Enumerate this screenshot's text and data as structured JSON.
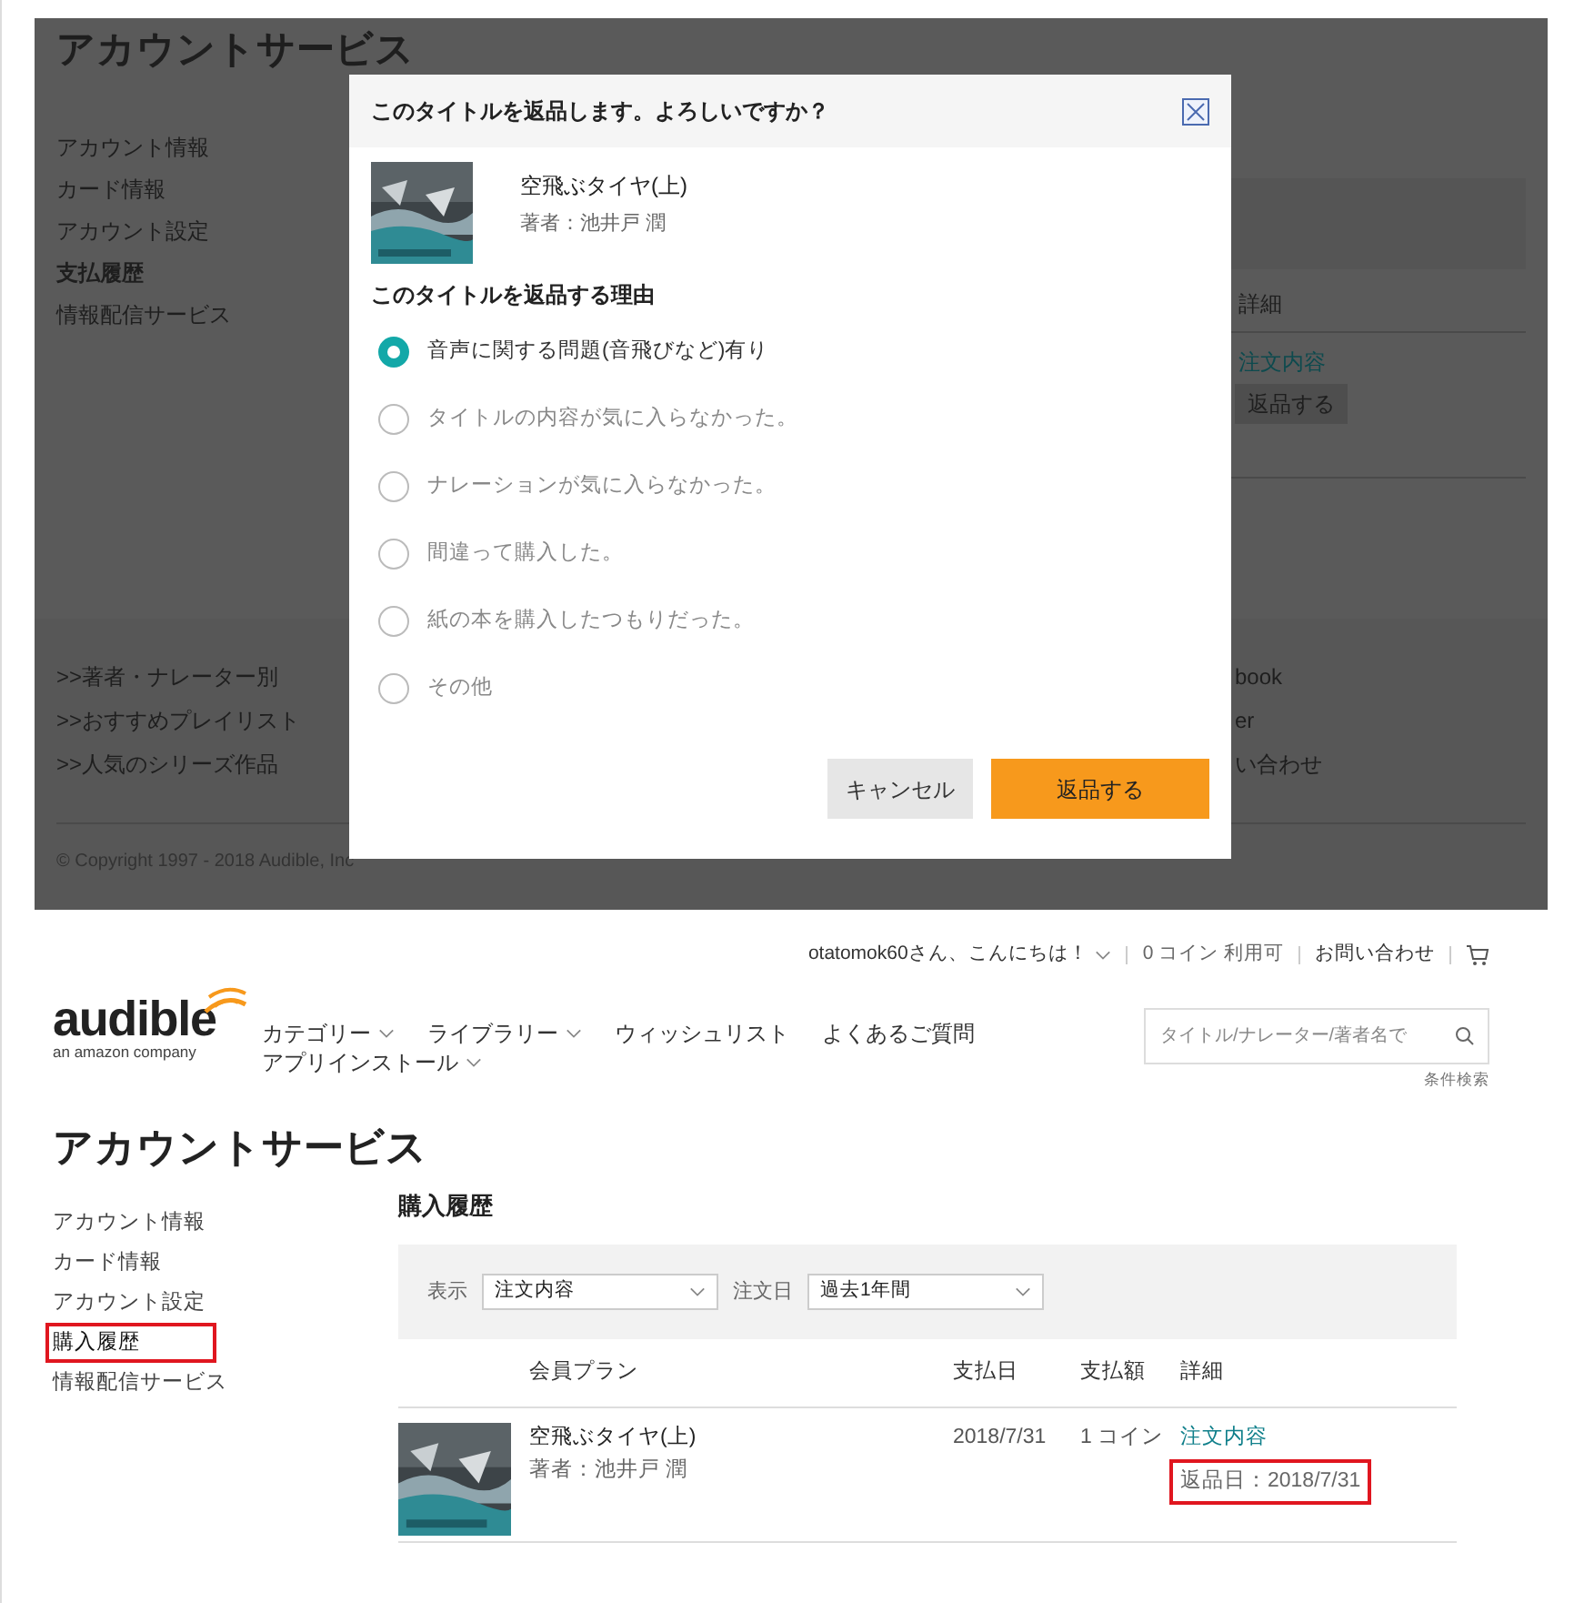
{
  "background_page": {
    "title": "アカウントサービス",
    "sidebar": [
      {
        "label": "アカウント情報",
        "selected": false
      },
      {
        "label": "カード情報",
        "selected": false
      },
      {
        "label": "アカウント設定",
        "selected": false
      },
      {
        "label": "支払履歴",
        "selected": true
      },
      {
        "label": "情報配信サービス",
        "selected": false
      }
    ],
    "detail_header": "詳細",
    "order_link": "注文内容",
    "return_button": "返品する",
    "footer_links": [
      ">>著者・ナレーター別",
      ">>おすすめプレイリスト",
      ">>人気のシリーズ作品"
    ],
    "footer_right": [
      "book",
      "er",
      "い合わせ"
    ],
    "copyright": "© Copyright 1997 - 2018 Audible, Inc"
  },
  "dialog": {
    "title": "このタイトルを返品します。よろしいですか？",
    "book": {
      "title": "空飛ぶタイヤ(上)",
      "author": "著者：池井戸 潤"
    },
    "reason_heading": "このタイトルを返品する理由",
    "reasons": [
      {
        "label": "音声に関する問題(音飛びなど)有り",
        "selected": true
      },
      {
        "label": "タイトルの内容が気に入らなかった。",
        "selected": false
      },
      {
        "label": "ナレーションが気に入らなかった。",
        "selected": false
      },
      {
        "label": "間違って購入した。",
        "selected": false
      },
      {
        "label": "紙の本を購入したつもりだった。",
        "selected": false
      },
      {
        "label": "その他",
        "selected": false
      }
    ],
    "buttons": [
      {
        "label": "キャンセル",
        "kind": "secondary"
      },
      {
        "label": "返品する",
        "kind": "primary"
      }
    ]
  },
  "page": {
    "header": {
      "greeting": "otatomok60さん、こんにちは！",
      "coins": "0 コイン 利用可",
      "contact": "お問い合わせ",
      "logo": {
        "name": "audible",
        "tagline": "an amazon company"
      },
      "nav": [
        {
          "label": "カテゴリー",
          "dropdown": true
        },
        {
          "label": "ライブラリー",
          "dropdown": true
        },
        {
          "label": "ウィッシュリスト",
          "dropdown": false
        },
        {
          "label": "よくあるご質問",
          "dropdown": false
        },
        {
          "label": "アプリインストール",
          "dropdown": true
        }
      ],
      "search": {
        "placeholder": "タイトル/ナレーター/著者名で"
      },
      "advanced_search": "条件検索"
    },
    "title": "アカウントサービス",
    "sidebar": [
      {
        "label": "アカウント情報",
        "selected": false,
        "highlighted": false
      },
      {
        "label": "カード情報",
        "selected": false,
        "highlighted": false
      },
      {
        "label": "アカウント設定",
        "selected": false,
        "highlighted": false
      },
      {
        "label": "購入履歴",
        "selected": true,
        "highlighted": true
      },
      {
        "label": "情報配信サービス",
        "selected": false,
        "highlighted": false
      }
    ],
    "section_title": "購入履歴",
    "filters": [
      {
        "label": "表示",
        "value": "注文内容"
      },
      {
        "label": "注文日",
        "value": "過去1年間"
      }
    ],
    "table": {
      "columns": [
        "会員プラン",
        "支払日",
        "支払額",
        "詳細"
      ],
      "rows": [
        {
          "title": "空飛ぶタイヤ(上)",
          "author": "著者：池井戸 潤",
          "date": "2018/7/31",
          "amount": "1 コイン",
          "link": "注文内容",
          "return_date": {
            "text": "返品日：2018/7/31",
            "highlighted": true
          }
        }
      ]
    }
  }
}
